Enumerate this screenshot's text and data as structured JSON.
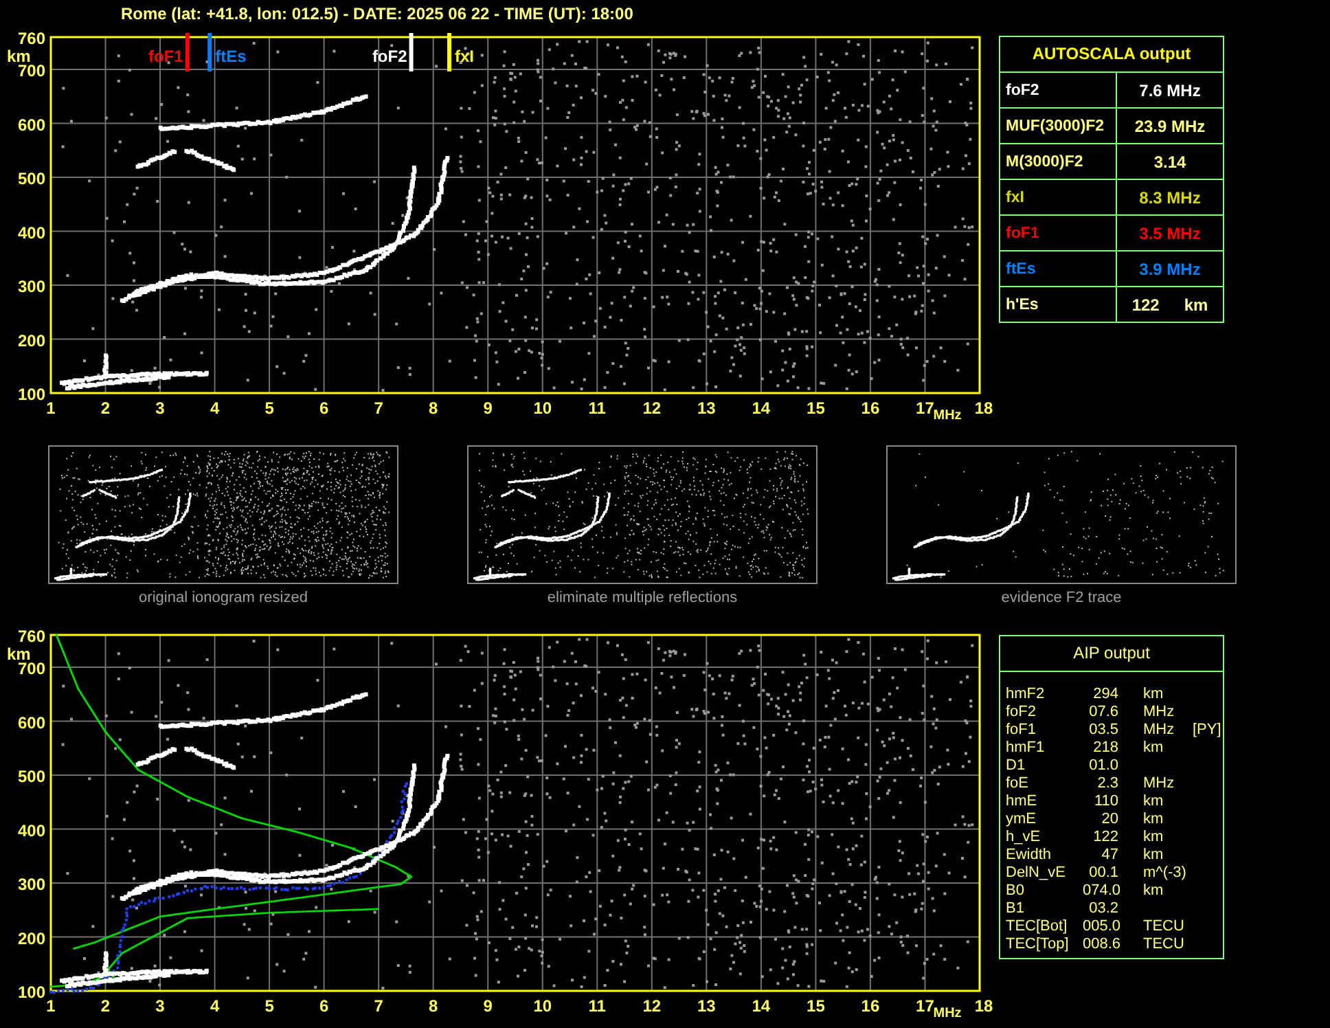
{
  "header": {
    "title": "Rome (lat: +41.8, lon: 012.5) - DATE: 2025 06 22 - TIME (UT): 18:00"
  },
  "ionogram": {
    "y_unit": "km",
    "x_unit": "MHz",
    "yticks": [
      "760",
      "700",
      "600",
      "500",
      "400",
      "300",
      "200",
      "100"
    ],
    "xticks": [
      "1",
      "2",
      "3",
      "4",
      "5",
      "6",
      "7",
      "8",
      "9",
      "10",
      "11",
      "12",
      "13",
      "14",
      "15",
      "16",
      "17",
      "18"
    ],
    "markers": [
      {
        "label": "foF1",
        "color": "#ff0000",
        "level": 0.147,
        "label_right": false
      },
      {
        "label": "ftEs",
        "color": "#0080ff",
        "level": 0.171,
        "label_right": true
      },
      {
        "label": "foF2",
        "color": "#ffffff",
        "level": 0.388,
        "label_right": false
      },
      {
        "label": "fxI",
        "color": "#ffff00",
        "level": 0.429,
        "label_right": true
      }
    ]
  },
  "autoscala": {
    "title": "AUTOSCALA output",
    "rows": [
      {
        "name": "foF2",
        "value": "7.6 MHz",
        "color": "#ffffff"
      },
      {
        "name": "MUF(3000)F2",
        "value": "23.9 MHz",
        "color": "#ffff80"
      },
      {
        "name": "M(3000)F2",
        "value": "3.14",
        "color": "#ffff80"
      },
      {
        "name": "fxI",
        "value": "8.3 MHz",
        "color": "#d8d800"
      },
      {
        "name": "foF1",
        "value": "3.5 MHz",
        "color": "#ff0000"
      },
      {
        "name": "ftEs",
        "value": "3.9 MHz",
        "color": "#0080ff"
      },
      {
        "name": "h'Es",
        "value": "122",
        "unit": "km",
        "color": "#ffffa0"
      }
    ]
  },
  "thumbnails": [
    {
      "caption": "original ionogram resized"
    },
    {
      "caption": "eliminate multiple reflections"
    },
    {
      "caption": "evidence F2 trace"
    }
  ],
  "aip_ionogram": {
    "y_unit": "km",
    "x_unit": "MHz",
    "yticks": [
      "760",
      "700",
      "600",
      "500",
      "400",
      "300",
      "200",
      "100"
    ],
    "xticks": [
      "1",
      "2",
      "3",
      "4",
      "5",
      "6",
      "7",
      "8",
      "9",
      "10",
      "11",
      "12",
      "13",
      "14",
      "15",
      "16",
      "17",
      "18"
    ]
  },
  "aip": {
    "title": "AIP output",
    "rows": [
      {
        "name": "hmF2",
        "value": "294",
        "unit": "km"
      },
      {
        "name": "foF2",
        "value": "07.6",
        "unit": "MHz"
      },
      {
        "name": "foF1",
        "value": "03.5",
        "unit": "MHz",
        "flag": "[PY]"
      },
      {
        "name": "hmF1",
        "value": "218",
        "unit": "km"
      },
      {
        "name": "D1",
        "value": "01.0"
      },
      {
        "name": "foE",
        "value": "2.3",
        "unit": "MHz"
      },
      {
        "name": "hmE",
        "value": "110",
        "unit": "km"
      },
      {
        "name": "ymE",
        "value": "20",
        "unit": "km"
      },
      {
        "name": "h_vE",
        "value": "122",
        "unit": "km"
      },
      {
        "name": "Ewidth",
        "value": "47",
        "unit": "km"
      },
      {
        "name": "DelN_vE",
        "value": "00.1",
        "unit": "m^(-3)"
      },
      {
        "name": "B0",
        "value": "074.0",
        "unit": "km"
      },
      {
        "name": "B1",
        "value": "03.2"
      },
      {
        "name": "TEC[Bot]",
        "value": "005.0",
        "unit": "TECU"
      },
      {
        "name": "TEC[Top]",
        "value": "008.6",
        "unit": "TECU"
      }
    ]
  }
}
